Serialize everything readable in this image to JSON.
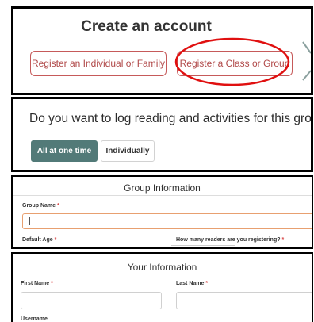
{
  "create_account": {
    "title": "Create an account",
    "individual_button": "Register an Individual or Family",
    "group_button": "Register a Class or Group"
  },
  "log_question": {
    "text": "Do you want to log reading and activities for this grou",
    "options": [
      "All at one time",
      "Individually"
    ],
    "selected": "All at one time"
  },
  "group_info": {
    "heading": "Group Information",
    "group_name_label": "Group Name",
    "group_name_value": "",
    "default_age_label": "Default Age",
    "readers_label": "How many readers are you registering?",
    "required_mark": "*"
  },
  "your_info": {
    "heading": "Your Information",
    "first_name_label": "First Name",
    "last_name_label": "Last Name",
    "username_label": "Username",
    "required_mark": "*"
  },
  "colors": {
    "accent_red": "#c65a5a",
    "highlight_ring": "#e01010",
    "selected_teal": "#527a78",
    "input_focus": "#e8a070",
    "required": "#d94848"
  }
}
